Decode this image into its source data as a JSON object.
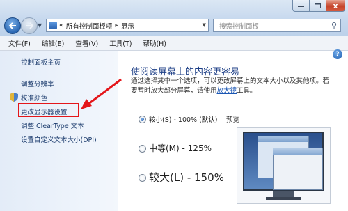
{
  "address": {
    "back_icon": "back-arrow-icon",
    "forward_icon": "forward-arrow-icon",
    "overflow": "«",
    "crumb_1": "所有控制面板项",
    "crumb_sep": "▸",
    "crumb_2": "显示",
    "search_placeholder": "搜索控制面板"
  },
  "window_buttons": {
    "close": "x"
  },
  "menu": [
    "文件(F)",
    "编辑(E)",
    "查看(V)",
    "工具(T)",
    "帮助(H)"
  ],
  "sidebar": {
    "home": "控制面板主页",
    "items": [
      "调整分辨率",
      "校准颜色",
      "更改显示器设置",
      "调整 ClearType 文本",
      "设置自定义文本大小(DPI)"
    ],
    "highlight_color": "#e4161a"
  },
  "main": {
    "title": "使阅读屏幕上的内容更容易",
    "desc_line1": "通过选择其中一个选项，可以更改屏幕上的文本大小以及其他项。若",
    "desc_line2_pre": "要暂时放大部分屏幕，请使用",
    "desc_link": "放大镜",
    "desc_line2_post": "工具。",
    "options": [
      {
        "label": "较小(S) - 100% (默认)",
        "selected": true
      },
      {
        "label": "中等(M) - 125%",
        "selected": false
      },
      {
        "label": "较大(L) - 150%",
        "selected": false
      }
    ],
    "preview_label": "预览"
  },
  "help_icon": "?"
}
